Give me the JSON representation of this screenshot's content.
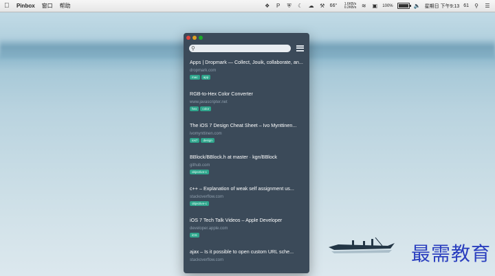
{
  "menubar": {
    "app_name": "Pinbox",
    "menus": [
      "窗口",
      "帮助"
    ],
    "tray_p": "P",
    "temperature": "66°",
    "net_up": "1.6KB/s",
    "net_down": "0.2KB/s",
    "battery": "100%",
    "battery_level": 1.0,
    "clock": "星期日 下午9:13",
    "extra": "61"
  },
  "app": {
    "search": {
      "placeholder": "",
      "value": ""
    },
    "bookmarks": [
      {
        "title": "Apps | Dropmark — Collect, Jouik, collaborate, an...",
        "url": "dropmark.com",
        "tags": [
          "mac",
          "app"
        ]
      },
      {
        "title": "RGB-to-Hex Color Converter",
        "url": "www.javascripter.net",
        "tags": [
          "hex",
          "color"
        ]
      },
      {
        "title": "The iOS 7 Design Cheat Sheet – Ivo Mynttinen...",
        "url": "ivomynttinen.com",
        "tags": [
          "ios7",
          "design"
        ]
      },
      {
        "title": "BBlock/BBlock.h at master · kgn/BBlock",
        "url": "github.com",
        "tags": [
          "objective-c"
        ]
      },
      {
        "title": "c++ – Explanation of weak self assignment us...",
        "url": "stackoverflow.com",
        "tags": [
          "objective-c"
        ]
      },
      {
        "title": "iOS 7 Tech Talk Videos – Apple Developer",
        "url": "developer.apple.com",
        "tags": [
          "iOS"
        ]
      },
      {
        "title": "ajax – Is it possible to open custom URL sche...",
        "url": "stackoverflow.com",
        "tags": []
      }
    ]
  },
  "watermark": "最需教育"
}
